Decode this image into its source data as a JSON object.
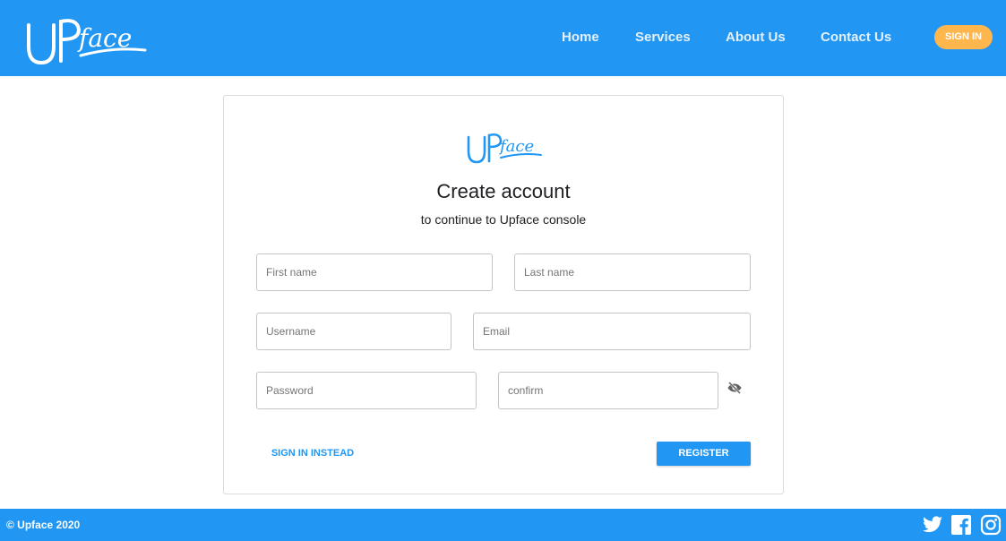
{
  "brand": {
    "logo_text": "Upface",
    "primary_color": "#2196f3",
    "accent_color": "#ffb74d"
  },
  "nav": {
    "links": [
      {
        "label": "Home"
      },
      {
        "label": "Services"
      },
      {
        "label": "About Us"
      },
      {
        "label": "Contact Us"
      }
    ],
    "signin_label": "SIGN IN"
  },
  "form": {
    "title": "Create account",
    "subtitle": "to continue to Upface console",
    "fields": {
      "first_name": {
        "placeholder": "First name",
        "value": ""
      },
      "last_name": {
        "placeholder": "Last name",
        "value": ""
      },
      "username": {
        "placeholder": "Username",
        "value": ""
      },
      "email": {
        "placeholder": "Email",
        "value": ""
      },
      "password": {
        "placeholder": "Password",
        "value": ""
      },
      "confirm": {
        "placeholder": "confirm",
        "value": ""
      }
    },
    "visibility_toggle_icon": "eye-off-icon",
    "signin_instead_label": "SIGN IN INSTEAD",
    "register_label": "REGISTER"
  },
  "footer": {
    "copyright": "© Upface 2020",
    "social_icons": [
      "twitter-icon",
      "facebook-icon",
      "instagram-icon"
    ]
  }
}
